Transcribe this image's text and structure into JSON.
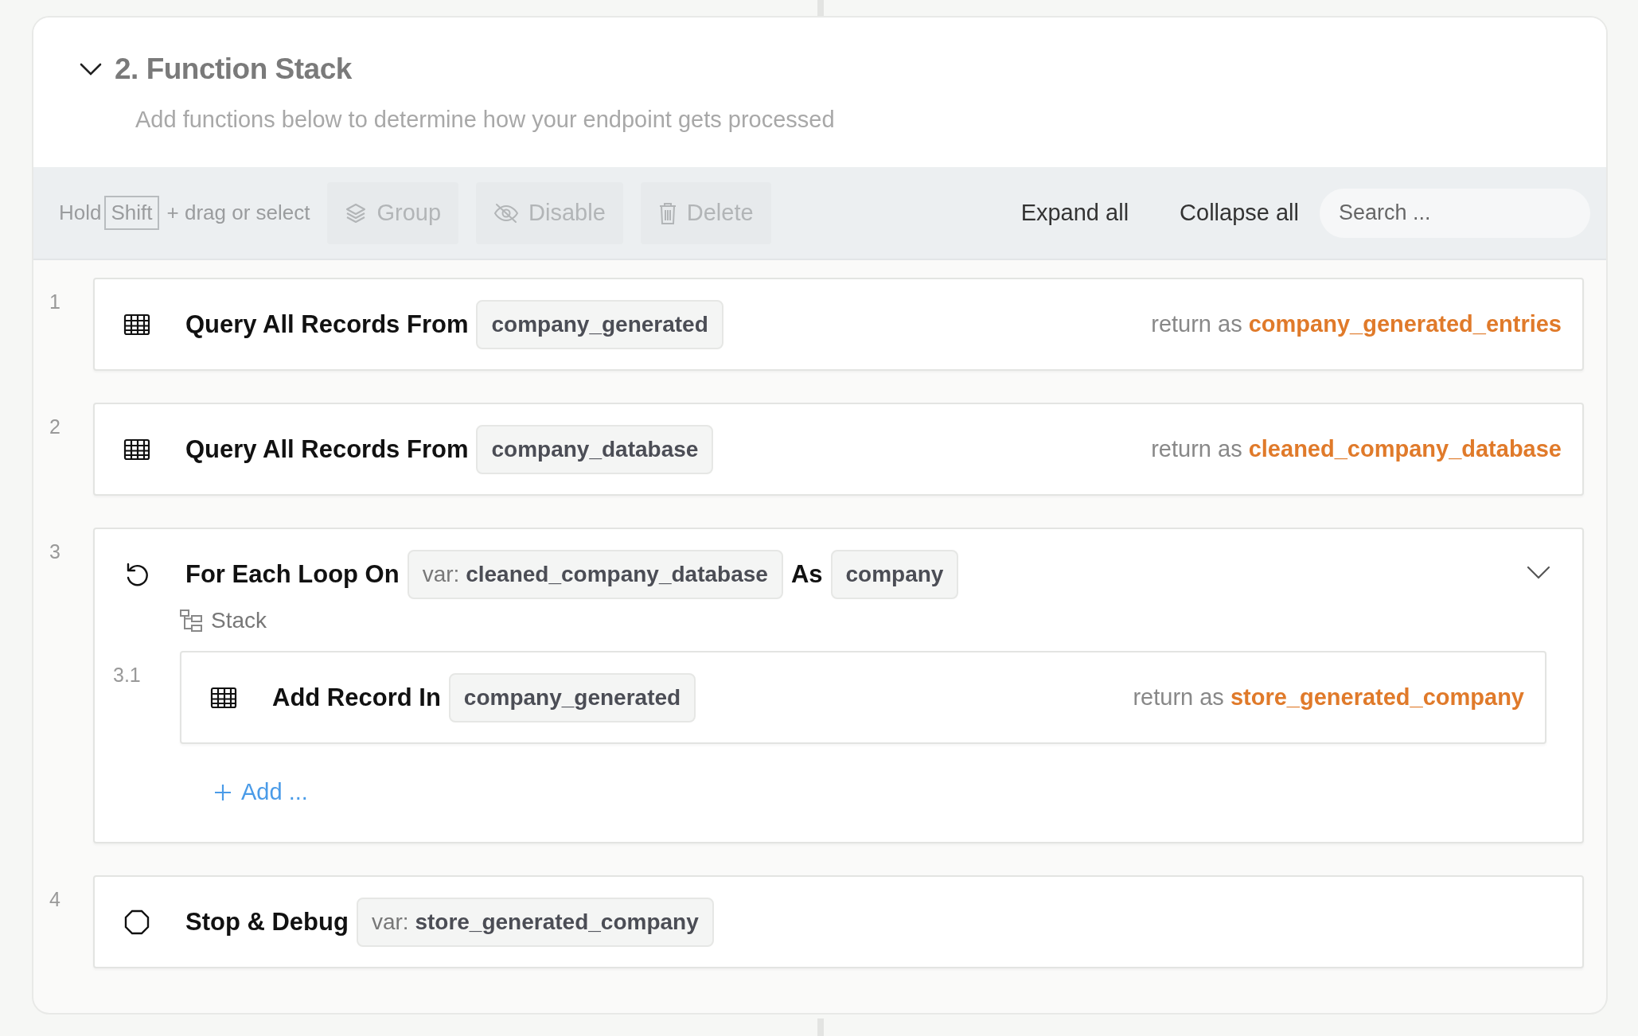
{
  "section": {
    "title": "2. Function Stack",
    "expanded": true,
    "description": "Add functions below to determine how your endpoint gets processed"
  },
  "toolbar": {
    "hint_before": "Hold",
    "hint_key": "Shift",
    "hint_after": "+ drag or select",
    "actions": [
      {
        "kind": "group",
        "label": "Group",
        "disabled": true
      },
      {
        "kind": "disable",
        "label": "Disable",
        "disabled": true
      },
      {
        "kind": "delete",
        "label": "Delete",
        "disabled": true
      }
    ],
    "expand_all": "Expand all",
    "collapse_all": "Collapse all",
    "search": {
      "placeholder": "Search ..."
    }
  },
  "steps": [
    {
      "number": "1",
      "kind": "query",
      "title": "Query All Records From",
      "args": [
        {
          "value": "company_generated"
        }
      ],
      "return_label": "return as",
      "return_var": "company_generated_entries"
    },
    {
      "number": "2",
      "kind": "query",
      "title": "Query All Records From",
      "args": [
        {
          "value": "company_database"
        }
      ],
      "return_label": "return as",
      "return_var": "cleaned_company_database"
    },
    {
      "number": "3",
      "kind": "loop",
      "title": "For Each Loop On",
      "args": [
        {
          "prefix": "var:",
          "value": "cleaned_company_database"
        },
        {
          "connector": "As",
          "value": "company"
        }
      ],
      "expanded": true,
      "stack_label": "Stack",
      "add_label": "Add ...",
      "children": [
        {
          "number": "3.1",
          "kind": "add",
          "title": "Add Record In",
          "args": [
            {
              "value": "company_generated"
            }
          ],
          "return_label": "return as",
          "return_var": "store_generated_company"
        }
      ]
    },
    {
      "number": "4",
      "kind": "stop",
      "title": "Stop & Debug",
      "args": [
        {
          "prefix": "var:",
          "value": "store_generated_company"
        }
      ]
    }
  ]
}
